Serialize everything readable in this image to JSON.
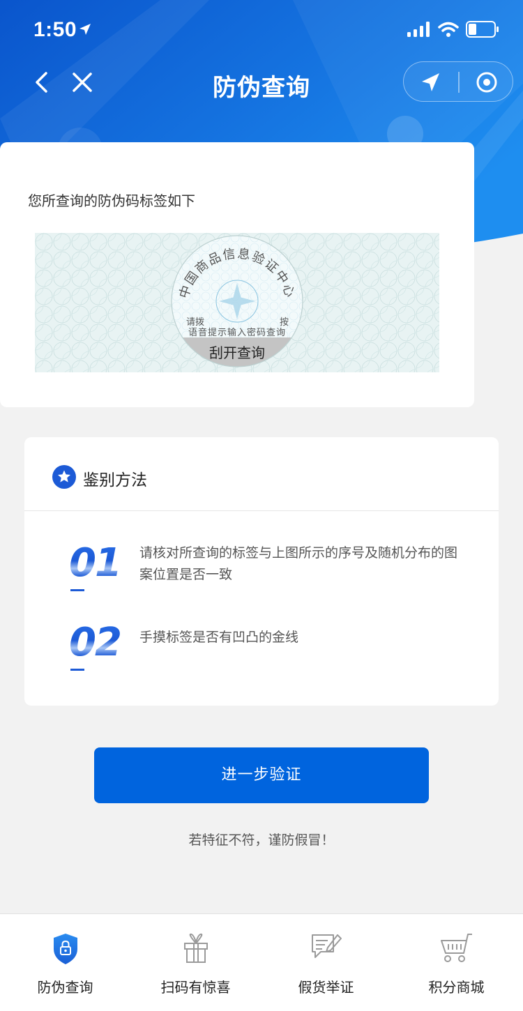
{
  "status_bar": {
    "time": "1:50"
  },
  "nav": {
    "title": "防伪查询"
  },
  "label_card": {
    "intro": "您所查询的防伪码标签如下",
    "seal": {
      "ring_text": "中国商品信息验证中心",
      "line1_left": "请拨",
      "line1_right": "按",
      "line2": "语音提示输入密码查询",
      "scratch": "刮开查询"
    }
  },
  "method_card": {
    "title": "鉴别方法",
    "steps": [
      {
        "num": "01",
        "text": "请核对所查询的标签与上图所示的序号及随机分布的图案位置是否一致"
      },
      {
        "num": "02",
        "text": "手摸标签是否有凹凸的金线"
      }
    ]
  },
  "verify_button": {
    "label": "进一步验证"
  },
  "warning": "若特征不符，谨防假冒！",
  "tabbar": {
    "tabs": [
      {
        "label": "防伪查询",
        "icon": "shield-lock-icon",
        "active": true
      },
      {
        "label": "扫码有惊喜",
        "icon": "gift-icon",
        "active": false
      },
      {
        "label": "假货举证",
        "icon": "report-icon",
        "active": false
      },
      {
        "label": "积分商城",
        "icon": "cart-icon",
        "active": false
      }
    ]
  },
  "colors": {
    "primary": "#0064de",
    "header_dark": "#0a58cf",
    "header_light": "#1e8ef0",
    "background": "#f2f2f2"
  }
}
